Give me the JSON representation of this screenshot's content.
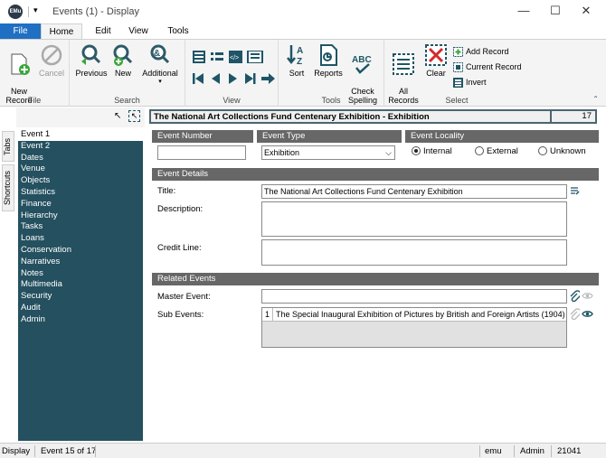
{
  "window": {
    "title": "Events (1) - Display",
    "logo_text": "EMu",
    "minimize": "—",
    "maximize": "☐",
    "close": "✕"
  },
  "ribbon_tabs": [
    "File",
    "Home",
    "Edit",
    "View",
    "Tools"
  ],
  "ribbon": {
    "file_group": {
      "label": "File",
      "new_record": "New\nRecord",
      "cancel": "Cancel"
    },
    "search_group": {
      "label": "Search",
      "previous": "Previous",
      "new": "New",
      "additional": "Additional"
    },
    "view_group": {
      "label": "View"
    },
    "tools_group": {
      "label": "Tools",
      "sort": "Sort",
      "reports": "Reports",
      "check_spelling": "Check\nSpelling"
    },
    "select_group": {
      "label": "Select",
      "all_records": "All\nRecords",
      "clear": "Clear",
      "add_record": "Add Record",
      "current_record": "Current Record",
      "invert": "Invert"
    }
  },
  "side_tabs": {
    "tabs": "Tabs",
    "shortcuts": "Shortcuts"
  },
  "nav_items": [
    "Event 1",
    "Event 2",
    "Dates",
    "Venue",
    "Objects",
    "Statistics",
    "Finance",
    "Hierarchy",
    "Tasks",
    "Loans",
    "Conservation",
    "Narratives",
    "Notes",
    "Multimedia",
    "Security",
    "Audit",
    "Admin"
  ],
  "record": {
    "heading": "The National Art Collections Fund Centenary Exhibition - Exhibition",
    "count": "17"
  },
  "fields": {
    "event_number_label": "Event Number",
    "event_number_value": "",
    "event_type_label": "Event Type",
    "event_type_value": "Exhibition",
    "event_locality_label": "Event Locality",
    "locality_options": [
      "Internal",
      "External",
      "Unknown"
    ],
    "locality_selected": "Internal",
    "event_details_label": "Event Details",
    "title_label": "Title:",
    "title_value": "The National Art Collections Fund Centenary Exhibition",
    "description_label": "Description:",
    "description_value": "",
    "credit_line_label": "Credit Line:",
    "credit_line_value": "",
    "related_events_label": "Related Events",
    "master_event_label": "Master Event:",
    "master_event_value": "",
    "sub_events_label": "Sub Events:",
    "sub_events": [
      {
        "index": "1",
        "value": "The Special Inaugural Exhibition of Pictures by British  and Foreign Artists (1904)"
      }
    ]
  },
  "status": {
    "mode": "Display",
    "position": "Event 15 of 17",
    "module": "emu",
    "user": "Admin",
    "id": "21041"
  },
  "colors": {
    "file_tab": "#1f6fc3",
    "nav_bg": "#24505f",
    "section_bg": "#676767",
    "header_border": "#4c6571"
  }
}
